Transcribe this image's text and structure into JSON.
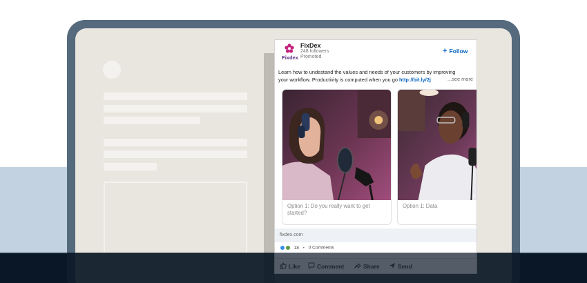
{
  "colors": {
    "link_blue": "#0a66c2",
    "laptop_frame": "#556a7d",
    "screen_bg": "#e9e6e0",
    "logo_magenta": "#c4227c",
    "logo_purple": "#5b2d8a"
  },
  "post": {
    "company_name": "FixDex",
    "logo_text": "Fixdex",
    "followers": "248 followers",
    "promoted": "Promoted",
    "follow_label": "Follow",
    "text_line1": "Learn how to undestand the values and needs of your customers by improving",
    "text_line2": "your workflow. Productivity is computed when you go ",
    "link_text": "http://bit.ly/2j",
    "see_more": "...see more",
    "cards": [
      {
        "caption": "Option 1: Do you really want to get started?"
      },
      {
        "caption": "Option 1: Data"
      }
    ],
    "next_icon": "chevron-right-icon",
    "link_domain": "fixdex.com",
    "reaction_count": "18",
    "comments": "0 Comments",
    "actions": {
      "like": "Like",
      "comment": "Comment",
      "share": "Share",
      "send": "Send"
    }
  }
}
